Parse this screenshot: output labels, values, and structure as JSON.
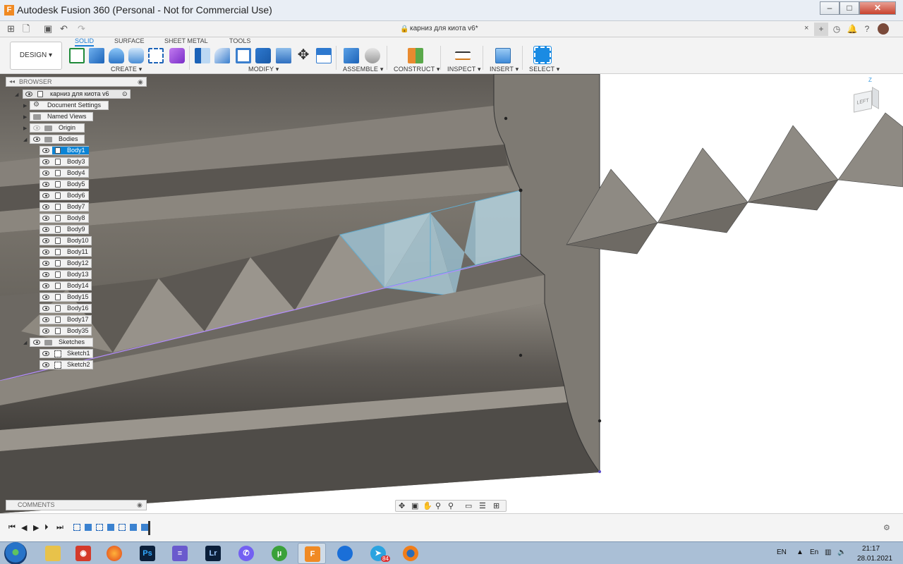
{
  "window": {
    "title": "Autodesk Fusion 360 (Personal - Not for Commercial Use)",
    "app_icon": "F",
    "min": "–",
    "max": "□",
    "close": "✕"
  },
  "tabbar": {
    "doc_title": "карниз для киота v6*",
    "close": "×"
  },
  "toolbar": {
    "workspace": "DESIGN ▾",
    "tabs": [
      "SOLID",
      "SURFACE",
      "SHEET METAL",
      "TOOLS"
    ],
    "groups": [
      "CREATE ▾",
      "MODIFY ▾",
      "ASSEMBLE ▾",
      "CONSTRUCT ▾",
      "INSPECT ▾",
      "INSERT ▾",
      "SELECT ▾"
    ]
  },
  "browser": {
    "header": "BROWSER",
    "root": "карниз для киота v6",
    "items": [
      "Document Settings",
      "Named Views",
      "Origin",
      "Bodies"
    ],
    "bodies": [
      "Body1",
      "Body3",
      "Body4",
      "Body5",
      "Body6",
      "Body7",
      "Body8",
      "Body9",
      "Body10",
      "Body11",
      "Body12",
      "Body13",
      "Body14",
      "Body15",
      "Body16",
      "Body17",
      "Body35"
    ],
    "sketches_label": "Sketches",
    "sketches": [
      "Sketch1",
      "Sketch2"
    ]
  },
  "comments": {
    "label": "COMMENTS"
  },
  "viewcube": {
    "face": "LEFT",
    "axis_z": "Z"
  },
  "taskbar": {
    "apps": [
      "explorer",
      "snip",
      "firefox",
      "photoshop",
      "notes",
      "lightroom",
      "viber",
      "utorrent",
      "fusion",
      "zoom",
      "telegram",
      "blender"
    ],
    "ps": "Ps",
    "lr": "Lr",
    "telegram_badge": "84",
    "lang": "EN",
    "tray_lang": "En",
    "time": "21:17",
    "date": "28.01.2021"
  },
  "colors": {
    "accent": "#0a84d6",
    "model": "#6f6b65",
    "selected_face": "#a9c9d6",
    "sketch_line": "#b38cff"
  }
}
